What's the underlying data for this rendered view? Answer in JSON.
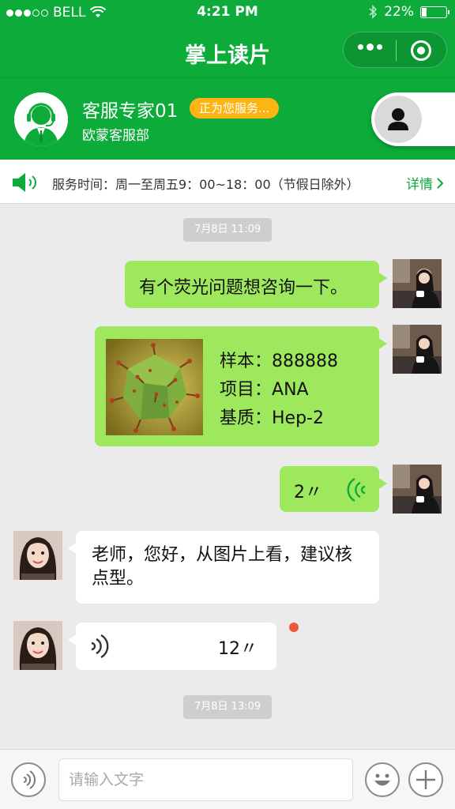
{
  "status_bar": {
    "carrier": "BELL",
    "time": "4:21 PM",
    "battery": "22%",
    "battery_level": 0.22,
    "signal_bars_filled": 3,
    "signal_bars_total": 5
  },
  "nav": {
    "title": "掌上读片"
  },
  "agent": {
    "name": "客服专家01",
    "status_badge": "正为您服务...",
    "department": "欧蒙客服部"
  },
  "notice": {
    "text": "服务时间：周一至周五9：00~18：00（节假日除外）",
    "detail_label": "详情"
  },
  "chat": {
    "timestamps": [
      "7月8日 11:09",
      "7月8日 13:09"
    ],
    "messages": [
      {
        "from": "me",
        "type": "text",
        "text": "有个荧光问题想咨询一下。"
      },
      {
        "from": "me",
        "type": "card",
        "sample_label": "样本：",
        "sample_value": "888888",
        "item_label": "项目：",
        "item_value": "ANA",
        "matrix_label": "基质：",
        "matrix_value": "Hep-2"
      },
      {
        "from": "me",
        "type": "voice",
        "duration": "2〃"
      },
      {
        "from": "other",
        "type": "text",
        "text": "老师，您好，从图片上看，建议核点型。"
      },
      {
        "from": "other",
        "type": "voice",
        "duration": "12〃",
        "unread": true
      }
    ]
  },
  "input": {
    "placeholder": "请输入文字"
  },
  "colors": {
    "brand_green": "#0dab3a",
    "my_bubble": "#9ee85e",
    "badge_yellow": "#fdb515",
    "unread_red": "#f0583c"
  }
}
